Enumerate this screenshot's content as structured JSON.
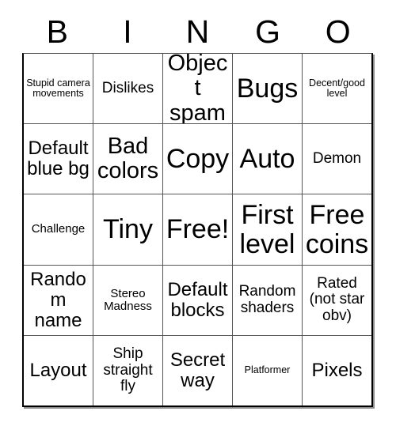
{
  "card": {
    "header_letters": [
      "B",
      "I",
      "N",
      "G",
      "O"
    ],
    "free_space_label": "Free!",
    "colors": {
      "text": "#000000",
      "grid_line": "#555555",
      "outer_border": "#000000",
      "shadow": "#8c8c8c",
      "background": "#ffffff"
    },
    "rows": [
      [
        {
          "label": "Stupid camera movements",
          "size": "xs"
        },
        {
          "label": "Dislikes",
          "size": "m"
        },
        {
          "label": "Object spam",
          "size": "xl"
        },
        {
          "label": "Bugs",
          "size": "xxl"
        },
        {
          "label": "Decent/good level",
          "size": "xs"
        }
      ],
      [
        {
          "label": "Default blue bg",
          "size": "l"
        },
        {
          "label": "Bad colors",
          "size": "xl"
        },
        {
          "label": "Copy",
          "size": "xxl"
        },
        {
          "label": "Auto",
          "size": "xxl"
        },
        {
          "label": "Demon",
          "size": "m"
        }
      ],
      [
        {
          "label": "Challenge",
          "size": "s"
        },
        {
          "label": "Tiny",
          "size": "xxl"
        },
        {
          "label": "Free!",
          "size": "xxl"
        },
        {
          "label": "First level",
          "size": "xxl"
        },
        {
          "label": "Free coins",
          "size": "xxl"
        }
      ],
      [
        {
          "label": "Random name",
          "size": "l"
        },
        {
          "label": "Stereo Madness",
          "size": "s"
        },
        {
          "label": "Default blocks",
          "size": "l"
        },
        {
          "label": "Random shaders",
          "size": "m"
        },
        {
          "label": "Rated (not star obv)",
          "size": "m"
        }
      ],
      [
        {
          "label": "Layout",
          "size": "l"
        },
        {
          "label": "Ship straight fly",
          "size": "m"
        },
        {
          "label": "Secret way",
          "size": "l"
        },
        {
          "label": "Platformer",
          "size": "xs"
        },
        {
          "label": "Pixels",
          "size": "l"
        }
      ]
    ]
  }
}
